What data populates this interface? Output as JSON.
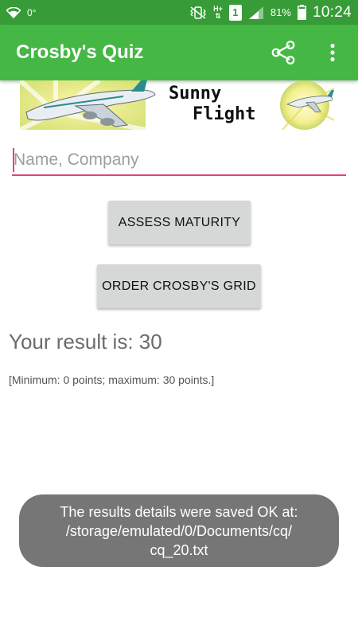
{
  "status_bar": {
    "indicator_text": "0°",
    "network_type": "H+",
    "sim_slot": "1",
    "battery_percent": "81%",
    "time": "10:24"
  },
  "app_bar": {
    "title": "Crosby's Quiz",
    "share_icon": "share-icon",
    "overflow_icon": "overflow-menu-icon",
    "color": "#45B745"
  },
  "banner": {
    "line1": "Sunny",
    "line2": "Flight"
  },
  "form": {
    "name_placeholder": "Name, Company",
    "name_value": ""
  },
  "buttons": {
    "assess": "ASSESS MATURITY",
    "order_grid": "ORDER CROSBY'S GRID"
  },
  "result": {
    "text": "Your result is: 30",
    "range_note": "[Minimum: 0 points; maximum: 30 points.]"
  },
  "toast": {
    "line1": "The results details were saved OK at:",
    "line2": "/storage/emulated/0/Documents/cq/",
    "line3": "cq_20.txt"
  },
  "colors": {
    "status_bar": "#379C37",
    "app_bar": "#45B745",
    "input_accent": "#E0457A",
    "button_bg": "#D6D7D7",
    "toast_bg": "#767676"
  }
}
